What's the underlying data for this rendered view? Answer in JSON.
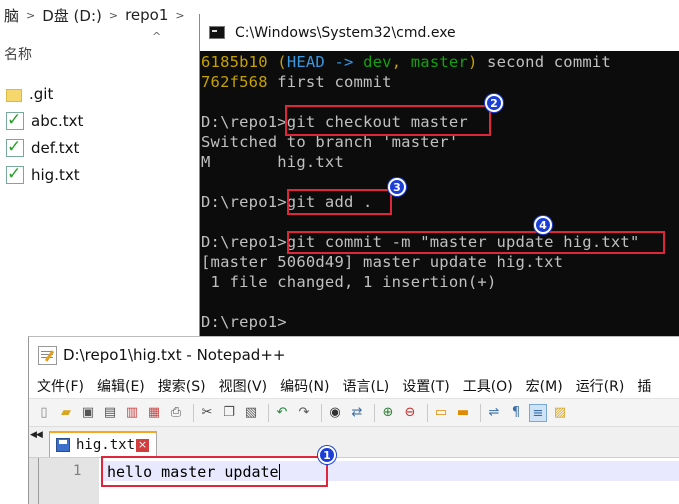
{
  "explorer": {
    "breadcrumb": [
      "脑",
      "D盘 (D:)",
      "repo1"
    ],
    "column_header": "名称",
    "files": [
      {
        "name": ".git",
        "icon": "folder-icon"
      },
      {
        "name": "abc.txt",
        "icon": "git-tracked-file-icon"
      },
      {
        "name": "def.txt",
        "icon": "git-tracked-file-icon"
      },
      {
        "name": "hig.txt",
        "icon": "git-tracked-file-icon"
      }
    ]
  },
  "cmd": {
    "title": "C:\\Windows\\System32\\cmd.exe",
    "log": [
      {
        "hash": "6185b10",
        "open": " (",
        "head": "HEAD -> ",
        "branch1": "dev",
        "comma": ", ",
        "branch2": "master",
        "close": ")",
        "msg": " second commit"
      },
      {
        "hash": "762f568",
        "msg": " first commit"
      }
    ],
    "prompt": "D:\\repo1>",
    "commands": {
      "checkout": "git checkout master",
      "checkout_out1": "Switched to branch 'master'",
      "checkout_out2": "M       hig.txt",
      "add": "git add .",
      "commit": "git commit -m \"master update hig.txt\"",
      "commit_out1": "[master 5060d49] master update hig.txt",
      "commit_out2": " 1 file changed, 1 insertion(+)"
    },
    "colors": {
      "hash": "#c5a100",
      "head": "#3a96dd",
      "branch": "#13a10e",
      "highlight": "#e0263a",
      "badge": "#1b3fd6"
    }
  },
  "notepad": {
    "title": "D:\\repo1\\hig.txt - Notepad++",
    "menu": [
      "文件(F)",
      "编辑(E)",
      "搜索(S)",
      "视图(V)",
      "编码(N)",
      "语言(L)",
      "设置(T)",
      "工具(O)",
      "宏(M)",
      "运行(R)",
      "插"
    ],
    "toolbar_icons": [
      "new-icon",
      "open-icon",
      "save-icon",
      "save-all-icon",
      "close-icon",
      "close-all-icon",
      "print-icon",
      "cut-icon",
      "copy-icon",
      "paste-icon",
      "undo-icon",
      "redo-icon",
      "find-icon",
      "replace-icon",
      "zoom-in-icon",
      "zoom-out-icon",
      "sync-v-icon",
      "sync-h-icon",
      "wrap-icon",
      "show-all-chars-icon",
      "indent-guide-icon",
      "user-lang-icon"
    ],
    "tab": {
      "label": "hig.txt",
      "close": "×"
    },
    "line_number": "1",
    "line_text": "hello master update"
  },
  "badges": [
    "1",
    "2",
    "3",
    "4"
  ]
}
